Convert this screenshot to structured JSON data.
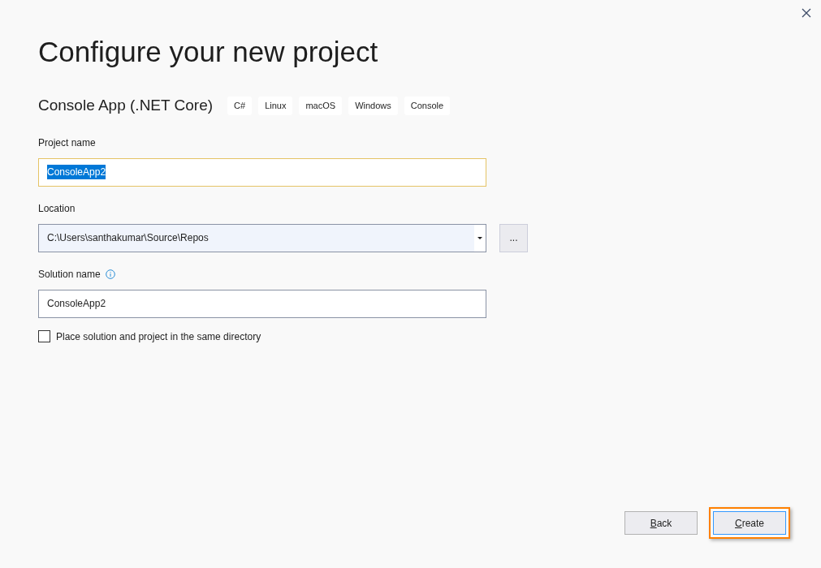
{
  "dialog": {
    "title": "Configure your new project"
  },
  "template": {
    "name": "Console App (.NET Core)",
    "tags": [
      "C#",
      "Linux",
      "macOS",
      "Windows",
      "Console"
    ]
  },
  "fields": [
    {
      "kind": "text",
      "label": "Project name",
      "value": "ConsoleApp2",
      "focused": true,
      "text_selected": true
    },
    {
      "kind": "combo",
      "label": "Location",
      "value": "C:\\Users\\santhakumar\\Source\\Repos",
      "focused": false,
      "browse": "..."
    },
    {
      "kind": "text",
      "label": "Solution name",
      "value": "ConsoleApp2",
      "focused": false,
      "info": true
    }
  ],
  "checkbox": {
    "label": "Place solution and project in the same directory",
    "checked": false
  },
  "buttons": [
    {
      "label": "Back",
      "underline_first": true,
      "focused": false,
      "highlighted": false
    },
    {
      "label": "Create",
      "underline_first": true,
      "focused": true,
      "highlighted": true
    }
  ]
}
